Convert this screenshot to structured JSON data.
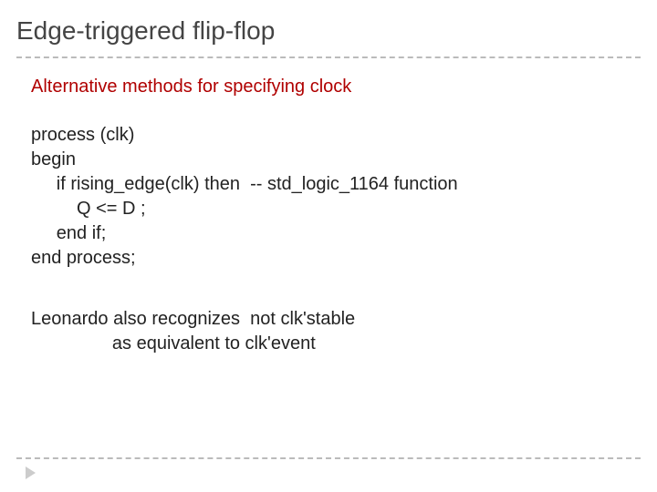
{
  "title": "Edge-triggered flip-flop",
  "subtitle": "Alternative methods for specifying clock",
  "code": {
    "l1": "process (clk)",
    "l2": "begin",
    "l3": "     if rising_edge(clk) then  -- std_logic_1164 function",
    "l4": "         Q <= D ;",
    "l5": "     end if;",
    "l6": "end process;"
  },
  "note": {
    "l1": "Leonardo also recognizes  not clk'stable",
    "l2": "                as equivalent to clk'event"
  }
}
